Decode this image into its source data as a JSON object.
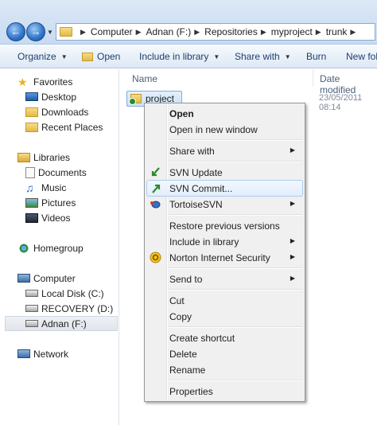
{
  "address": {
    "back_icon": "back-arrow-icon",
    "forward_icon": "forward-arrow-icon",
    "crumbs": [
      "Computer",
      "Adnan (F:)",
      "Repositories",
      "myproject",
      "trunk"
    ]
  },
  "toolbar": {
    "organize": "Organize",
    "open": "Open",
    "include_in_library": "Include in library",
    "share_with": "Share with",
    "burn": "Burn",
    "new_folder": "New folder"
  },
  "nav": {
    "favorites": "Favorites",
    "desktop": "Desktop",
    "downloads": "Downloads",
    "recent_places": "Recent Places",
    "libraries": "Libraries",
    "documents": "Documents",
    "music": "Music",
    "pictures": "Pictures",
    "videos": "Videos",
    "homegroup": "Homegroup",
    "computer": "Computer",
    "local_disk": "Local Disk (C:)",
    "recovery": "RECOVERY (D:)",
    "adnan": "Adnan (F:)",
    "network": "Network"
  },
  "content": {
    "col_name": "Name",
    "col_date": "Date modified",
    "file_name": "project",
    "file_date": "23/05/2011 08:14"
  },
  "menu": {
    "open": "Open",
    "open_new_window": "Open in new window",
    "share_with": "Share with",
    "svn_update": "SVN Update",
    "svn_commit": "SVN Commit...",
    "tortoisesvn": "TortoiseSVN",
    "restore_prev": "Restore previous versions",
    "include_in_library": "Include in library",
    "norton": "Norton Internet Security",
    "send_to": "Send to",
    "cut": "Cut",
    "copy": "Copy",
    "create_shortcut": "Create shortcut",
    "delete": "Delete",
    "rename": "Rename",
    "properties": "Properties"
  },
  "colors": {
    "selection": "#cbe2fa",
    "hover_border": "#aeccf2",
    "menu_bg": "#f0f0f0"
  }
}
